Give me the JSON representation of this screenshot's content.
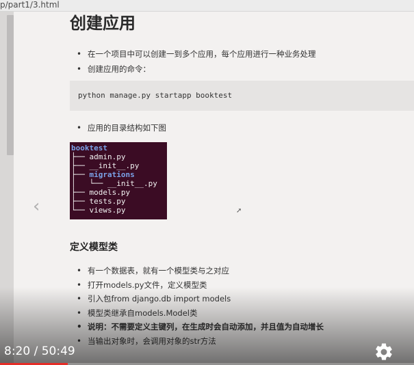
{
  "browser": {
    "url": "p/part1/3.html"
  },
  "doc": {
    "title": "创建应用",
    "bullets_1": [
      "在一个项目中可以创建一到多个应用，每个应用进行一种业务处理",
      "创建应用的命令："
    ],
    "code_command": "python manage.py startapp booktest",
    "bullets_2": [
      "应用的目录结构如下图"
    ],
    "tree": {
      "root": "booktest",
      "lines": [
        {
          "prefix": "├── ",
          "name": "admin.py",
          "type": "file"
        },
        {
          "prefix": "├── ",
          "name": "__init__.py",
          "type": "file"
        },
        {
          "prefix": "├── ",
          "name": "migrations",
          "type": "dir"
        },
        {
          "prefix": "│   └── ",
          "name": "__init__.py",
          "type": "file"
        },
        {
          "prefix": "├── ",
          "name": "models.py",
          "type": "file"
        },
        {
          "prefix": "├── ",
          "name": "tests.py",
          "type": "file"
        },
        {
          "prefix": "└── ",
          "name": "views.py",
          "type": "file"
        }
      ]
    },
    "section_title": "定义模型类",
    "bullets_3": [
      {
        "text": "有一个数据表，就有一个模型类与之对应",
        "bold": false
      },
      {
        "text": "打开models.py文件，定义模型类",
        "bold": false
      },
      {
        "text": "引入包from django.db import models",
        "bold": false
      },
      {
        "text": "模型类继承自models.Model类",
        "bold": false
      },
      {
        "text": "说明：不需要定义主键列，在生成时会自动添加，并且值为自动增长",
        "bold": true
      },
      {
        "text": "当输出对象时，会调用对象的str方法",
        "bold": false
      }
    ]
  },
  "player": {
    "time_display": "8:20 / 50:49",
    "progress_fraction": 0.164,
    "prev_icon": "chevron-left-icon",
    "settings_icon": "gear-icon",
    "accent_color": "#e52d27"
  }
}
